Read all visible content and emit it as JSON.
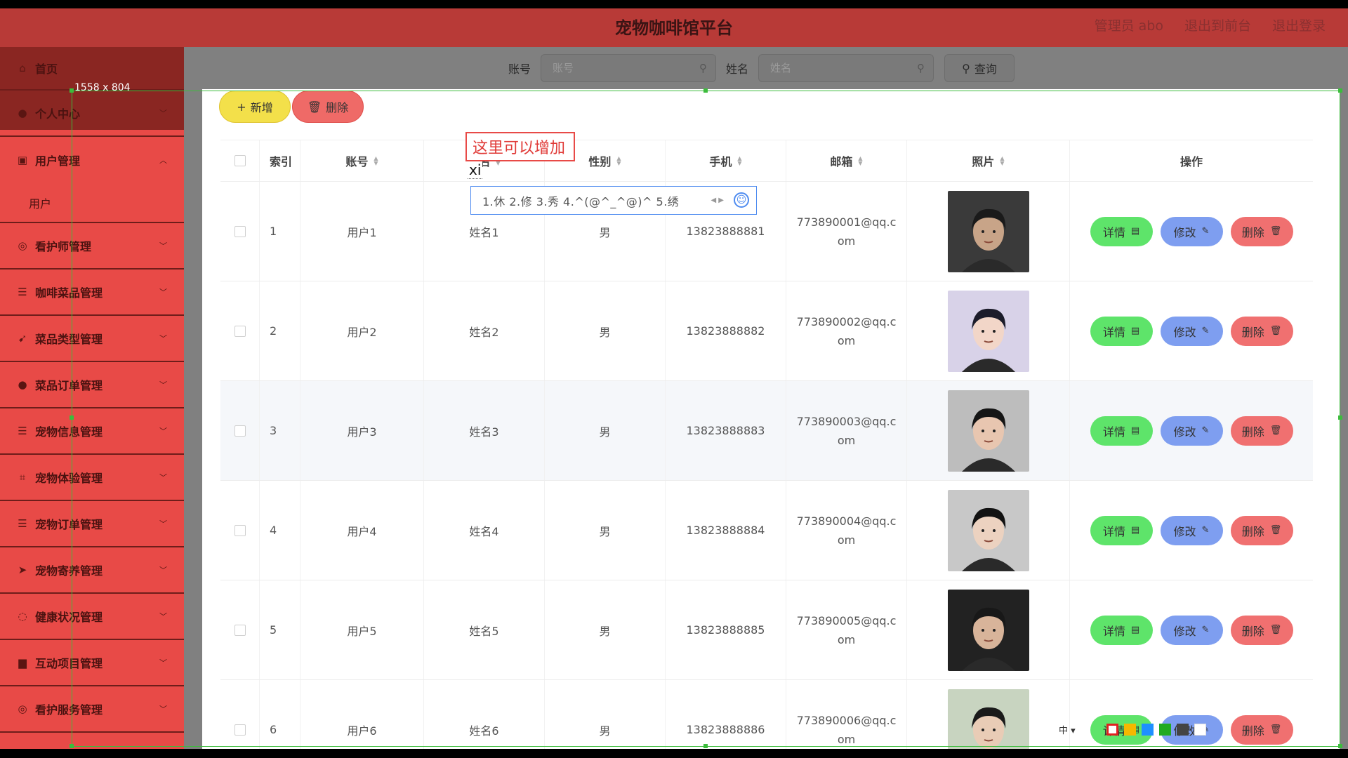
{
  "app": {
    "title": "宠物咖啡馆平台",
    "size_label": "1558 x 804"
  },
  "header": {
    "links": [
      "管理员 abo",
      "退出到前台",
      "退出登录"
    ]
  },
  "sidebar": {
    "items": [
      {
        "label": "首页",
        "icon": "home-icon"
      },
      {
        "label": "个人中心",
        "icon": "user-icon"
      },
      {
        "label": "用户管理",
        "icon": "users-icon"
      },
      {
        "label": "用户",
        "icon": ""
      },
      {
        "label": "看护师管理",
        "icon": "nurse-icon"
      },
      {
        "label": "咖啡菜品管理",
        "icon": "list-icon"
      },
      {
        "label": "菜品类型管理",
        "icon": "tag-icon"
      },
      {
        "label": "菜品订单管理",
        "icon": "order-icon"
      },
      {
        "label": "宠物信息管理",
        "icon": "paw-icon"
      },
      {
        "label": "宠物体验管理",
        "icon": "crop-icon"
      },
      {
        "label": "宠物订单管理",
        "icon": "list-icon"
      },
      {
        "label": "宠物寄养管理",
        "icon": "send-icon"
      },
      {
        "label": "健康状况管理",
        "icon": "health-icon"
      },
      {
        "label": "互动项目管理",
        "icon": "board-icon"
      },
      {
        "label": "看护服务管理",
        "icon": "service-icon"
      }
    ]
  },
  "search": {
    "account_label": "账号",
    "account_placeholder": "账号",
    "name_label": "姓名",
    "name_placeholder": "姓名",
    "query_label": "查询"
  },
  "toolbar": {
    "add_label": "新增",
    "delete_label": "删除"
  },
  "table": {
    "headers": [
      "索引",
      "账号",
      "姓名",
      "性别",
      "手机",
      "邮箱",
      "照片",
      "操作"
    ],
    "rows": [
      {
        "index": "1",
        "account": "用户1",
        "name": "姓名1",
        "gender": "男",
        "phone": "13823888881",
        "email": "773890001@qq.com"
      },
      {
        "index": "2",
        "account": "用户2",
        "name": "姓名2",
        "gender": "男",
        "phone": "13823888882",
        "email": "773890002@qq.com"
      },
      {
        "index": "3",
        "account": "用户3",
        "name": "姓名3",
        "gender": "男",
        "phone": "13823888883",
        "email": "773890003@qq.com"
      },
      {
        "index": "4",
        "account": "用户4",
        "name": "姓名4",
        "gender": "男",
        "phone": "13823888884",
        "email": "773890004@qq.com"
      },
      {
        "index": "5",
        "account": "用户5",
        "name": "姓名5",
        "gender": "男",
        "phone": "13823888885",
        "email": "773890005@qq.com"
      },
      {
        "index": "6",
        "account": "用户6",
        "name": "姓名6",
        "gender": "男",
        "phone": "13823888886",
        "email": "773890006@qq.com"
      }
    ],
    "actions": {
      "detail": "详情",
      "edit": "修改",
      "delete": "删除"
    }
  },
  "annotation": {
    "text": "这里可以增加"
  },
  "ime": {
    "composition": "xi",
    "candidates": "1.休  2.修  3.秀  4.^(@^_^@)^  5.绣"
  },
  "tray": {
    "lang": "中 ▾",
    "colors": [
      "#e02020",
      "#f5b800",
      "#1e90ff",
      "#22aa22",
      "#444444",
      "#ffffff"
    ]
  },
  "colors": {
    "sidebar": "#e84a47",
    "header": "#b83a37",
    "detail": "#5ee46a",
    "edit": "#7e9ef0",
    "delete": "#f07070",
    "add": "#f3e04a"
  }
}
